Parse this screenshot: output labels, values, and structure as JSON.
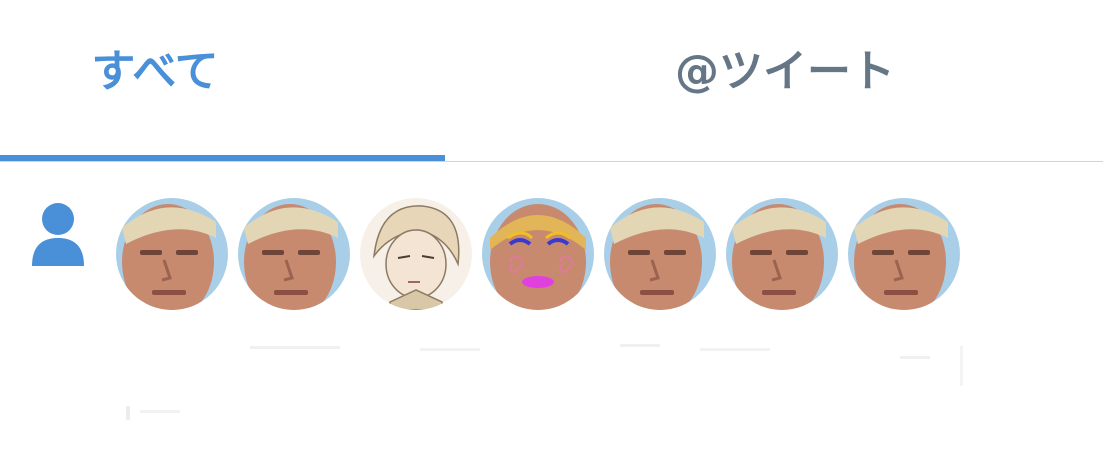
{
  "tabs": {
    "all_label": "すべて",
    "mentions_label": "@ツイート",
    "active": "all",
    "active_color": "#4a90d9",
    "inactive_color": "#657786"
  },
  "notification": {
    "type_icon": "person-icon",
    "icon_color": "#4a90d9",
    "avatars": [
      {
        "kind": "portrait-photo"
      },
      {
        "kind": "portrait-photo"
      },
      {
        "kind": "anime-illustration"
      },
      {
        "kind": "doodled-portrait"
      },
      {
        "kind": "portrait-photo"
      },
      {
        "kind": "portrait-photo"
      },
      {
        "kind": "portrait-photo"
      }
    ]
  }
}
